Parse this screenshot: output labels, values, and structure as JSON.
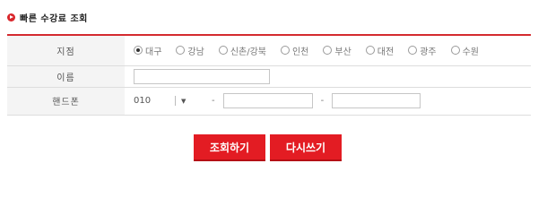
{
  "header": {
    "title": "빠른 수강료 조회"
  },
  "form": {
    "branch": {
      "label": "지점",
      "options": [
        "대구",
        "강남",
        "신촌/강북",
        "인천",
        "부산",
        "대전",
        "광주",
        "수원"
      ],
      "selected": "대구"
    },
    "name": {
      "label": "이름",
      "value": ""
    },
    "phone": {
      "label": "핸드폰",
      "prefix": "010",
      "dash": "-",
      "middle": "",
      "last": ""
    }
  },
  "buttons": {
    "search": "조회하기",
    "reset": "다시쓰기"
  },
  "colors": {
    "accent": "#e31c23",
    "table_border": "#d42a2f",
    "header_bg": "#f4f4f4"
  },
  "icons": {
    "header_bullet": "play-circle-icon",
    "select_arrow": "chevron-down-icon"
  }
}
